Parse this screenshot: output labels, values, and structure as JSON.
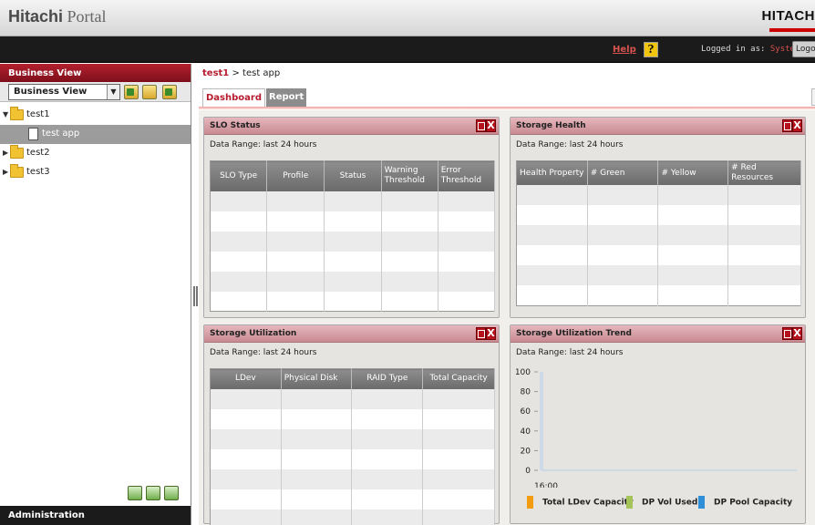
{
  "header": {
    "app_name_bold": "Hitachi",
    "app_name_rest": " Portal",
    "logo": "HITACH"
  },
  "navbar": {
    "help": "Help",
    "help_icon": "?",
    "logged_in_label": "Logged in as: ",
    "user": "System",
    "logout": "Logout"
  },
  "sidebar": {
    "title": "Business View",
    "view_select": "Business View",
    "tree": [
      {
        "label": "test1",
        "expanded": true
      },
      {
        "label": "test app",
        "selected": true
      },
      {
        "label": "test2"
      },
      {
        "label": "test3"
      }
    ],
    "admin": "Administration"
  },
  "breadcrumb": {
    "root": "test1",
    "sep": ">",
    "current": "test app"
  },
  "tabs": [
    {
      "label": "Dashboard",
      "active": true
    },
    {
      "label": "Report"
    }
  ],
  "panels": {
    "slo": {
      "title": "SLO Status",
      "range": "Data Range: last 24 hours",
      "columns": [
        "SLO Type",
        "Profile",
        "Status",
        "Warning Threshold",
        "Error Threshold"
      ]
    },
    "health": {
      "title": "Storage Health",
      "range": "Data Range: last 24 hours",
      "columns": [
        "Health Property",
        "# Green",
        "# Yellow",
        "# Red Resources"
      ]
    },
    "util": {
      "title": "Storage Utilization",
      "range": "Data Range: last 24 hours",
      "columns": [
        "LDev",
        "Physical Disk",
        "RAID Type",
        "Total Capacity"
      ]
    },
    "trend": {
      "title": "Storage Utilization Trend",
      "range": "Data Range: last 24 hours"
    }
  },
  "chart_data": {
    "type": "bar",
    "categories": [
      "16:00"
    ],
    "series": [
      {
        "name": "Total LDev Capacity",
        "color": "#f39c12",
        "values": [
          0
        ]
      },
      {
        "name": "DP Vol Used",
        "color": "#a4c45a",
        "values": [
          0
        ]
      },
      {
        "name": "DP Pool Capacity",
        "color": "#2e8ed8",
        "values": [
          0
        ]
      }
    ],
    "yticks": [
      "100",
      "80",
      "60",
      "40",
      "20",
      "0"
    ],
    "ylim": [
      0,
      100
    ],
    "grid": false,
    "legend": "bottom"
  },
  "colors": {
    "accent": "#b71c2e",
    "dark": "#1b1b1b"
  }
}
